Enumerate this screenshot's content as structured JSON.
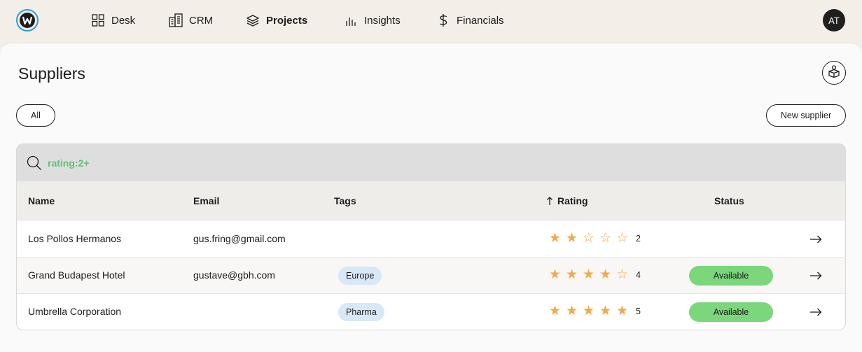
{
  "nav": {
    "items": [
      {
        "label": "Desk",
        "icon": "grid-icon"
      },
      {
        "label": "CRM",
        "icon": "building-icon"
      },
      {
        "label": "Projects",
        "icon": "layers-icon",
        "active": true
      },
      {
        "label": "Insights",
        "icon": "bar-chart-icon"
      },
      {
        "label": "Financials",
        "icon": "dollar-icon"
      }
    ],
    "avatar_initials": "AT"
  },
  "page": {
    "title": "Suppliers",
    "filter_label": "All",
    "new_button_label": "New supplier"
  },
  "search": {
    "value": "rating:2+",
    "text_color": "#5fc07c"
  },
  "table": {
    "columns": [
      "Name",
      "Email",
      "Tags",
      "Rating",
      "Status"
    ],
    "sort_column": "Rating",
    "rows": [
      {
        "name": "Los Pollos Hermanos",
        "email": "gus.fring@gmail.com",
        "tag": "",
        "rating": 2,
        "rating_label": "2",
        "status": ""
      },
      {
        "name": "Grand Budapest Hotel",
        "email": "gustave@gbh.com",
        "tag": "Europe",
        "rating": 4,
        "rating_label": "4",
        "status": "Available"
      },
      {
        "name": "Umbrella Corporation",
        "email": "",
        "tag": "Pharma",
        "rating": 5,
        "rating_label": "5",
        "status": "Available"
      }
    ]
  },
  "colors": {
    "star": "#f1a94a",
    "status_available": "#7bd67c",
    "tag_bg": "#d8e8f7",
    "logo_ring": "#2a9fd6"
  }
}
